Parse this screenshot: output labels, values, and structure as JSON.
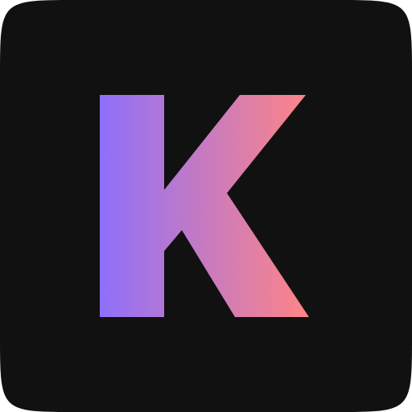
{
  "icon": {
    "name": "app-logo-icon",
    "glyph": "K",
    "colors": {
      "tile_background": "#111111",
      "page_background": "#ffffff",
      "gradient_start": "#8E70FB",
      "gradient_end": "#FF8585"
    }
  }
}
